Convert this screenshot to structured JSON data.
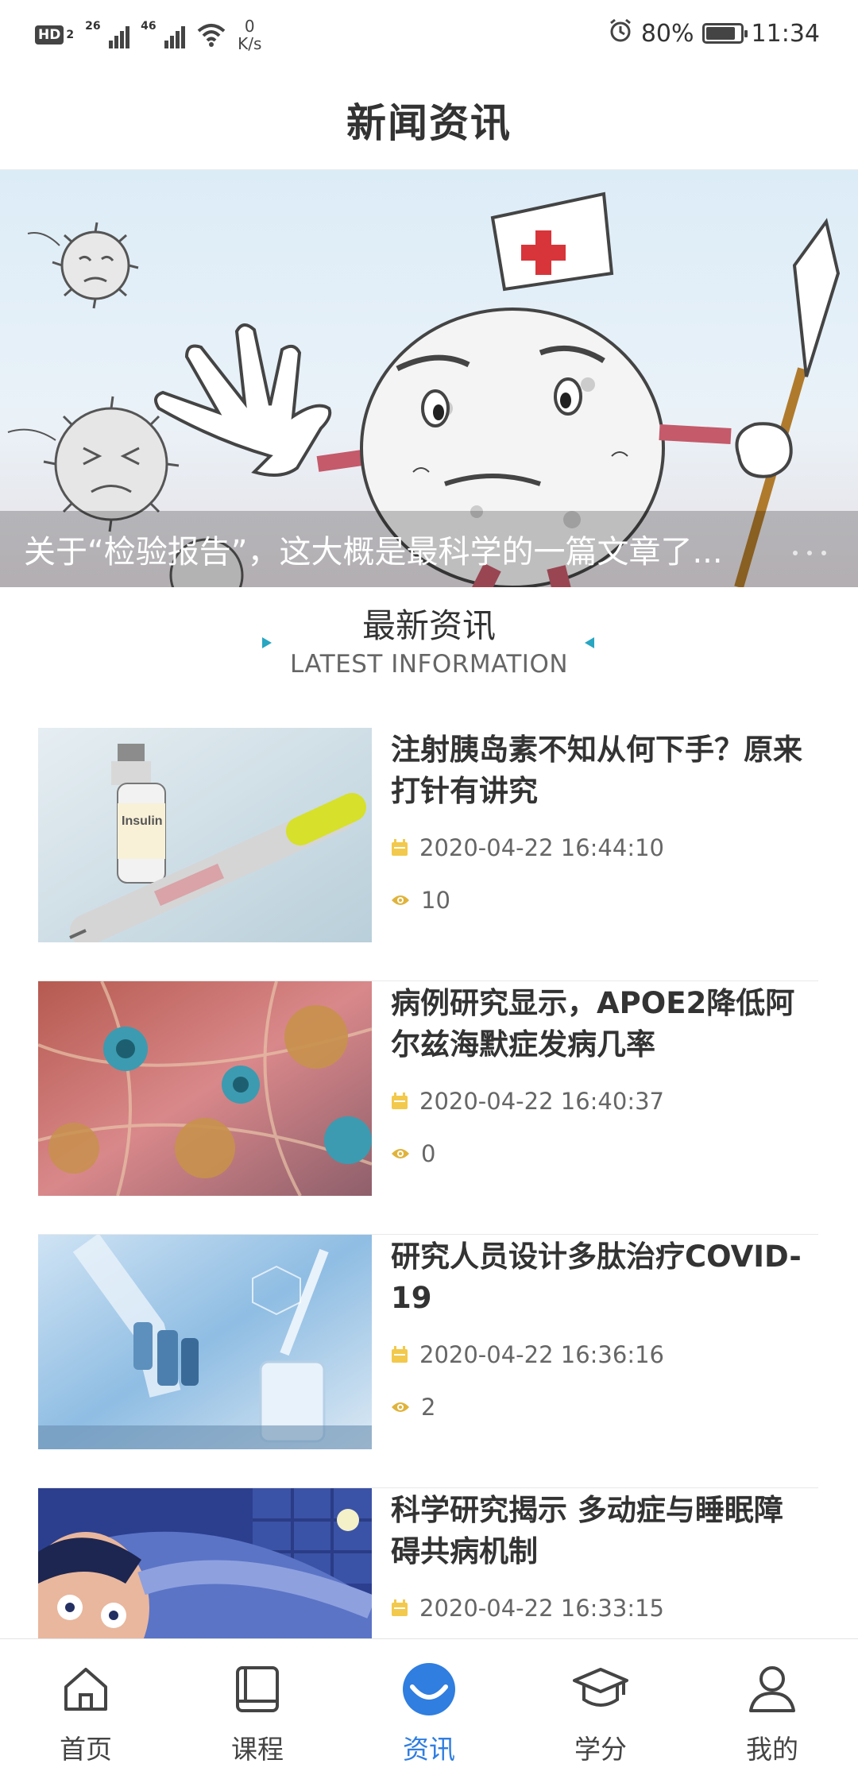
{
  "status_bar": {
    "hd_label": "HD",
    "sim_label": "2",
    "net1": "26",
    "net2": "46",
    "speed_value": "0",
    "speed_unit": "K/s",
    "battery": "80%",
    "time": "11:34"
  },
  "header": {
    "title": "新闻资讯"
  },
  "banner": {
    "caption": "关于“检验报告”，这大概是最科学的一篇文章了..."
  },
  "section": {
    "title_zh": "最新资讯",
    "title_en": "LATEST INFORMATION"
  },
  "news": [
    {
      "title": "注射胰岛素不知从何下手？原来打针有讲究",
      "date": "2020-04-22 16:44:10",
      "views": "10",
      "image": "insulin-pen"
    },
    {
      "title": "病例研究显示，APOE2降低阿尔兹海默症发病几率",
      "date": "2020-04-22 16:40:37",
      "views": "0",
      "image": "neurons"
    },
    {
      "title": "研究人员设计多肽治疗COVID-19",
      "date": "2020-04-22 16:36:16",
      "views": "2",
      "image": "lab-microscope"
    },
    {
      "title": "科学研究揭示 多动症与睡眠障碍共病机制",
      "date": "2020-04-22 16:33:15",
      "views": "",
      "image": "sleepless-man"
    }
  ],
  "tabs": [
    {
      "label": "首页",
      "icon": "home-icon",
      "active": false
    },
    {
      "label": "课程",
      "icon": "book-icon",
      "active": false
    },
    {
      "label": "资讯",
      "icon": "news-icon",
      "active": true
    },
    {
      "label": "学分",
      "icon": "graduation-cap-icon",
      "active": false
    },
    {
      "label": "我的",
      "icon": "user-icon",
      "active": false
    }
  ],
  "colors": {
    "accent": "#2f7ee0",
    "title_triangle": "#28a6c2",
    "meta_icon": "#f2c94c",
    "eye_icon": "#e0b33a"
  }
}
